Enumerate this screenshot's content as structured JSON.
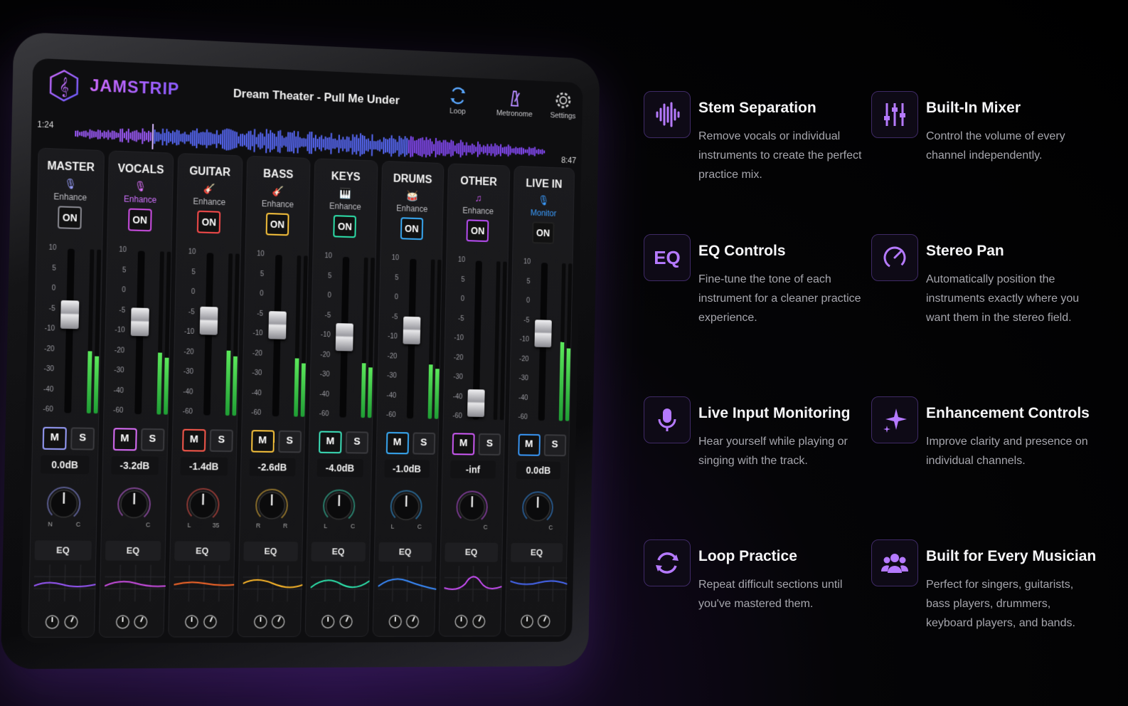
{
  "app": {
    "name": "JAMSTRIP"
  },
  "song": {
    "title": "Dream Theater - Pull Me Under"
  },
  "toolbar": {
    "loop_label": "Loop",
    "metronome_label": "Metronome",
    "settings_label": "Settings"
  },
  "playback": {
    "elapsed": "1:24",
    "total": "8:47",
    "progress": 0.16
  },
  "scale_ticks": [
    "10",
    "5",
    "0",
    "-5",
    "-10",
    "-20",
    "-30",
    "-40",
    "-60"
  ],
  "channels": [
    {
      "name": "MASTER",
      "mode": "Enhance",
      "state": "ON",
      "accent": "#9aa0ff",
      "icon": "mic-icon",
      "mute": "M",
      "solo": "S",
      "gain": "0.0dB",
      "fader": 0.62,
      "meter": 0.38,
      "pan_l": "N",
      "pan_r": "C",
      "eq": "EQ",
      "eq_color": "#9b59ff",
      "sub_color": "#bdbdc2",
      "on_border": "#8a8a92"
    },
    {
      "name": "VOCALS",
      "mode": "Enhance",
      "state": "ON",
      "accent": "#e070ff",
      "icon": "mic-icon",
      "mute": "M",
      "solo": "S",
      "gain": "-3.2dB",
      "fader": 0.58,
      "meter": 0.38,
      "pan_l": "",
      "pan_r": "C",
      "eq": "EQ",
      "eq_color": "#d04fe8",
      "sub_color": "#d070ff",
      "on_border": "#d04fe8"
    },
    {
      "name": "GUITAR",
      "mode": "Enhance",
      "state": "ON",
      "accent": "#ff5a4d",
      "icon": "guitar-icon",
      "mute": "M",
      "solo": "S",
      "gain": "-1.4dB",
      "fader": 0.6,
      "meter": 0.4,
      "pan_l": "L",
      "pan_r": "35",
      "eq": "EQ",
      "eq_color": "#ff6a2a",
      "sub_color": "#bdbdc2",
      "on_border": "#ff4d4d"
    },
    {
      "name": "BASS",
      "mode": "Enhance",
      "state": "ON",
      "accent": "#ffc83d",
      "icon": "guitar-icon",
      "mute": "M",
      "solo": "S",
      "gain": "-2.6dB",
      "fader": 0.58,
      "meter": 0.36,
      "pan_l": "R",
      "pan_r": "R",
      "eq": "EQ",
      "eq_color": "#ffb92a",
      "sub_color": "#bdbdc2",
      "on_border": "#ffc83d"
    },
    {
      "name": "KEYS",
      "mode": "Enhance",
      "state": "ON",
      "accent": "#3ee8c0",
      "icon": "keyboard-icon",
      "mute": "M",
      "solo": "S",
      "gain": "-4.0dB",
      "fader": 0.5,
      "meter": 0.34,
      "pan_l": "L",
      "pan_r": "C",
      "eq": "EQ",
      "eq_color": "#2ee8b0",
      "sub_color": "#bdbdc2",
      "on_border": "#2ee8b0"
    },
    {
      "name": "DRUMS",
      "mode": "Enhance",
      "state": "ON",
      "accent": "#3ab0ff",
      "icon": "drum-icon",
      "mute": "M",
      "solo": "S",
      "gain": "-1.0dB",
      "fader": 0.56,
      "meter": 0.34,
      "pan_l": "L",
      "pan_r": "C",
      "eq": "EQ",
      "eq_color": "#3a8cff",
      "sub_color": "#bdbdc2",
      "on_border": "#3ab0ff"
    },
    {
      "name": "OTHER",
      "mode": "Enhance",
      "state": "ON",
      "accent": "#d55cff",
      "icon": "music-note-icon",
      "mute": "M",
      "solo": "S",
      "gain": "-inf",
      "fader": 0.02,
      "meter": 0.0,
      "pan_l": "",
      "pan_r": "C",
      "eq": "EQ",
      "eq_color": "#d050ff",
      "sub_color": "#bdbdc2",
      "on_border": "#c050ff"
    },
    {
      "name": "LIVE IN",
      "mode": "Monitor",
      "state": "ON",
      "accent": "#3a9cff",
      "icon": "mic-icon",
      "mute": "M",
      "solo": "S",
      "gain": "0.0dB",
      "fader": 0.56,
      "meter": 0.5,
      "pan_l": "",
      "pan_r": "C",
      "eq": "EQ",
      "eq_color": "#4a6cff",
      "sub_color": "#3a9cff",
      "on_border": "#222"
    }
  ],
  "features": [
    {
      "title": "Stem Separation",
      "desc": "Remove vocals or individual instruments to create the perfect practice mix.",
      "icon": "waveform-icon"
    },
    {
      "title": "Built-In Mixer",
      "desc": "Control the volume of every channel independently.",
      "icon": "sliders-icon"
    },
    {
      "title": "EQ Controls",
      "desc": "Fine-tune the tone of each instrument for a cleaner practice experience.",
      "icon": "eq-icon",
      "icon_text": "EQ"
    },
    {
      "title": "Stereo Pan",
      "desc": "Automatically position the instruments exactly where you want them in the stereo field.",
      "icon": "pan-dial-icon"
    },
    {
      "title": "Live Input Monitoring",
      "desc": "Hear yourself while playing or singing with the track.",
      "icon": "microphone-icon"
    },
    {
      "title": "Enhancement Controls",
      "desc": "Improve clarity and presence on individual channels.",
      "icon": "sparkle-icon"
    },
    {
      "title": "Loop Practice",
      "desc": "Repeat difficult sections until you've mastered them.",
      "icon": "loop-icon"
    },
    {
      "title": "Built for Every Musician",
      "desc": "Perfect for singers, guitarists, bass players, drummers, keyboard players, and bands.",
      "icon": "users-icon"
    }
  ]
}
